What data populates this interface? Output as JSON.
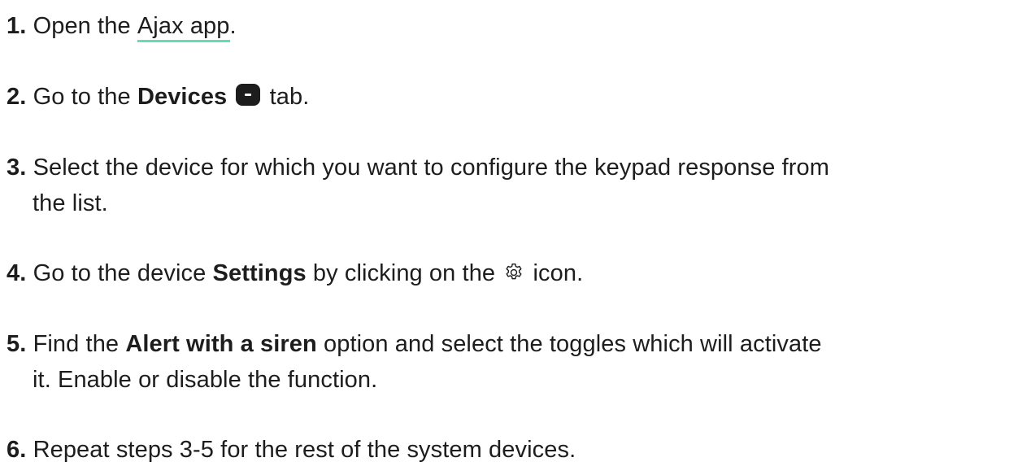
{
  "steps": [
    {
      "number": "1.",
      "before": "Open the",
      "link": "Ajax app",
      "after": "."
    },
    {
      "number": "2.",
      "before": "Go to the",
      "bold": "Devices",
      "icon": "devices-tab-icon",
      "after": "tab."
    },
    {
      "number": "3.",
      "line1": "Select the device for which you want to configure the keypad response from",
      "line2": "the list."
    },
    {
      "number": "4.",
      "before": "Go to the device",
      "bold": "Settings",
      "middle": "by clicking on the",
      "icon": "gear-icon",
      "after": "icon."
    },
    {
      "number": "5.",
      "before": "Find the",
      "bold": "Alert with a siren",
      "after": "option and select the toggles which will activate",
      "line2": "it. Enable or disable the function."
    },
    {
      "number": "6.",
      "text": "Repeat steps 3-5 for the rest of the system devices."
    }
  ],
  "colors": {
    "text": "#1d1d1d",
    "link_underline": "#5fe0b0",
    "background": "#ffffff"
  }
}
